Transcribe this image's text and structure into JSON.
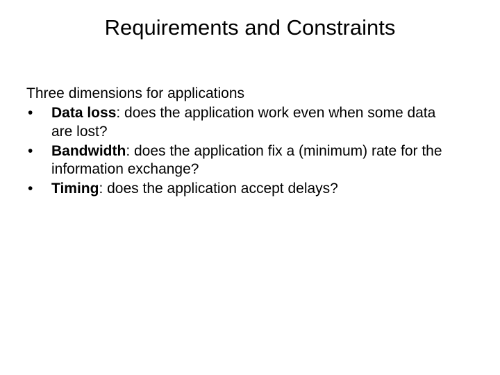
{
  "title": "Requirements and Constraints",
  "intro": "Three dimensions for applications",
  "bullets": [
    {
      "term": "Data loss",
      "rest": ": does the application work even when some data are lost?"
    },
    {
      "term": "Bandwidth",
      "rest": ": does the application fix a (minimum) rate for the information exchange?"
    },
    {
      "term": "Timing",
      "rest": ": does the application accept delays?"
    }
  ]
}
